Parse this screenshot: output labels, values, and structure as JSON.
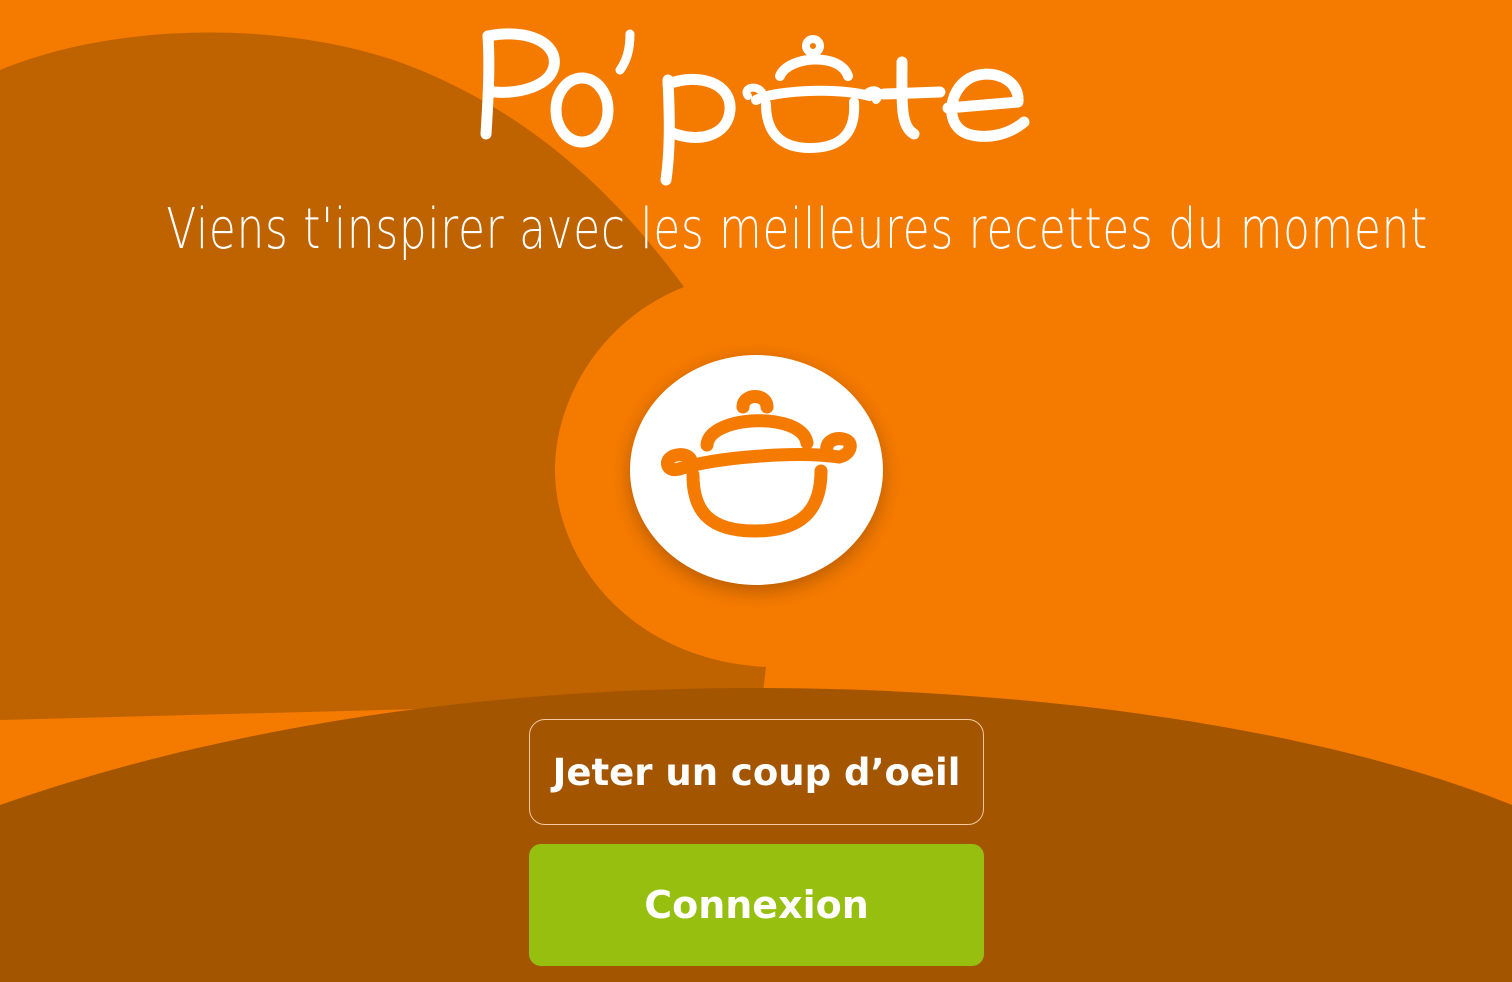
{
  "app": {
    "brand_text": "Po'pote"
  },
  "hero": {
    "tagline": "Viens t'inspirer avec les meilleures recettes du moment",
    "icon": "cooking-pot-icon"
  },
  "actions": {
    "browse_label": "Jeter un coup d’oeil",
    "login_label": "Connexion"
  },
  "colors": {
    "background_orange": "#f47a00",
    "shape_brown_light": "#bf6200",
    "shape_brown_dark": "#a35500",
    "primary_green": "#96bf0f",
    "white": "#ffffff"
  }
}
